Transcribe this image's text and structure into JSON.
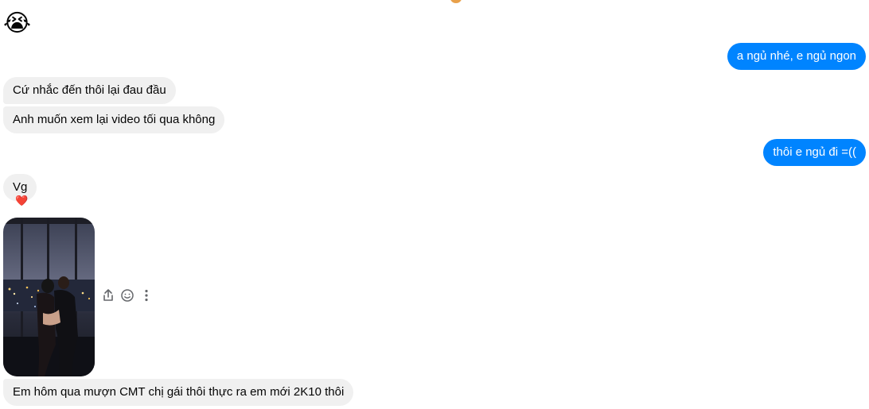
{
  "messages": {
    "m1_emoji": "😭",
    "m2_out": "a ngủ nhé, e ngủ ngon",
    "m3_in": "Cứ nhắc đến thôi lại đau đầu",
    "m4_in": "Anh muốn xem lại video tối qua không",
    "m5_out": "thôi e ngủ đi =((",
    "m6_in": "Vg",
    "m6_reaction": "❤️",
    "m8_in": "Em hôm qua mượn CMT chị gái thôi thực ra em mới 2K10 thôi"
  },
  "actions": {
    "share_icon": "share-icon",
    "react_icon": "smiley-icon",
    "more_icon": "more-vertical-icon"
  },
  "colors": {
    "outgoing": "#0084ff",
    "incoming": "#f0f0f0",
    "reaction_heart": "#e0245e"
  }
}
